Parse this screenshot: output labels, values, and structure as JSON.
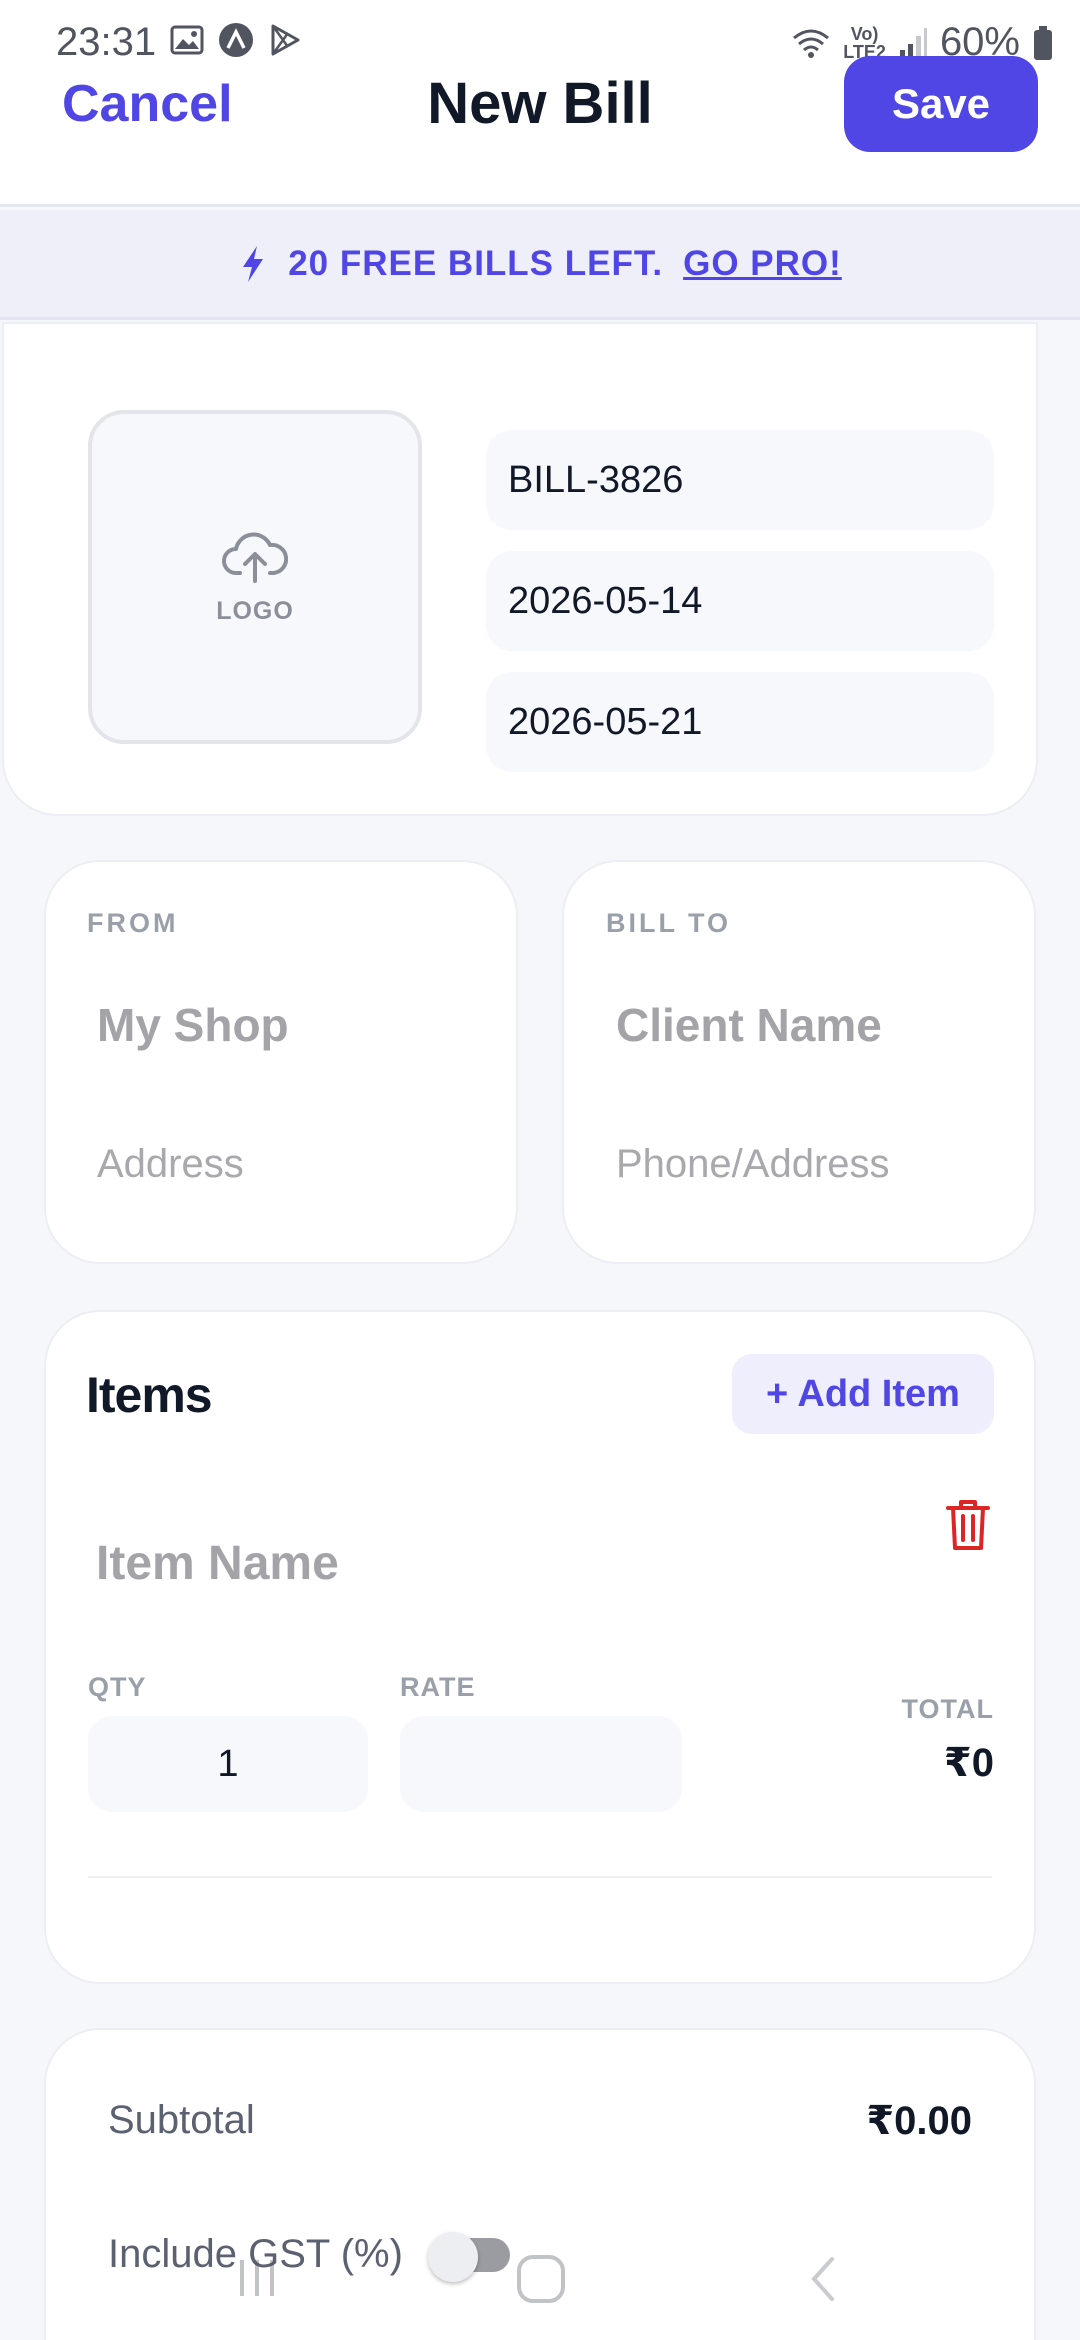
{
  "status_bar": {
    "time": "23:31",
    "network_top": "Vo)",
    "network_bottom": "LTE2",
    "battery": "60%"
  },
  "header": {
    "cancel_label": "Cancel",
    "title": "New Bill",
    "save_label": "Save"
  },
  "promo": {
    "icon": "bolt-icon",
    "text": "20 FREE BILLS LEFT.",
    "link": "GO PRO!"
  },
  "bill_meta": {
    "logo_label": "LOGO",
    "bill_number": "BILL-3826",
    "bill_date": "2026-05-14",
    "due_date": "2026-05-21"
  },
  "from": {
    "label": "FROM",
    "name_placeholder": "My Shop",
    "address_placeholder": "Address"
  },
  "bill_to": {
    "label": "BILL TO",
    "name_placeholder": "Client Name",
    "address_placeholder": "Phone/Address"
  },
  "items": {
    "title": "Items",
    "add_label": "+ Add Item",
    "rows": [
      {
        "name_placeholder": "Item Name",
        "qty_label": "QTY",
        "qty": "1",
        "rate_label": "RATE",
        "rate": "",
        "total_label": "TOTAL",
        "total": "₹0"
      }
    ]
  },
  "summary": {
    "subtotal_label": "Subtotal",
    "subtotal_value": "₹0.00",
    "gst_label": "Include GST (%)",
    "gst_enabled": false
  },
  "colors": {
    "accent": "#4f46e5",
    "danger": "#dc2626",
    "background": "#f6f7fb"
  }
}
